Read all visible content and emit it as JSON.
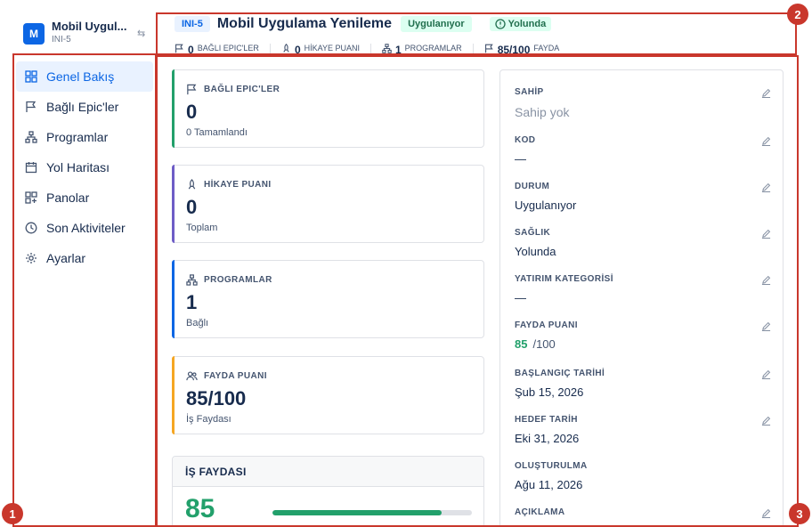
{
  "workspace": {
    "avatar_letter": "M",
    "name": "Mobil Uygul...",
    "key": "INI-5"
  },
  "sidebar": {
    "items": [
      {
        "label": "Genel Bakış",
        "icon": "grid-icon",
        "active": true
      },
      {
        "label": "Bağlı Epic'ler",
        "icon": "flag-icon",
        "active": false
      },
      {
        "label": "Programlar",
        "icon": "hierarchy-icon",
        "active": false
      },
      {
        "label": "Yol Haritası",
        "icon": "calendar-icon",
        "active": false
      },
      {
        "label": "Panolar",
        "icon": "dashboard-icon",
        "active": false
      },
      {
        "label": "Son Aktiviteler",
        "icon": "clock-icon",
        "active": false
      },
      {
        "label": "Ayarlar",
        "icon": "gear-icon",
        "active": false
      }
    ]
  },
  "header": {
    "key": "INI-5",
    "title": "Mobil Uygulama Yenileme",
    "status": "Uygulanıyor",
    "health": "Yolunda",
    "stats": [
      {
        "value": "0",
        "label": "BAĞLI EPIC'LER",
        "icon": "flag-icon"
      },
      {
        "value": "0",
        "label": "HİKAYE PUANI",
        "icon": "rocket-icon"
      },
      {
        "value": "1",
        "label": "PROGRAMLAR",
        "icon": "hierarchy-icon"
      },
      {
        "value": "85/100",
        "label": "FAYDA",
        "icon": "flag-icon"
      }
    ]
  },
  "cards": [
    {
      "title": "BAĞLI EPIC'LER",
      "value": "0",
      "sub": "0 Tamamlandı",
      "accent": "#22a06b",
      "icon": "flag-icon"
    },
    {
      "title": "HİKAYE PUANI",
      "value": "0",
      "sub": "Toplam",
      "accent": "#6e5dc6",
      "icon": "rocket-icon"
    },
    {
      "title": "PROGRAMLAR",
      "value": "1",
      "sub": "Bağlı",
      "accent": "#0c66e4",
      "icon": "hierarchy-icon"
    },
    {
      "title": "FAYDA PUANI",
      "value": "85/100",
      "sub": "İş Faydası",
      "accent": "#f5a623",
      "icon": "users-icon"
    }
  ],
  "business_value": {
    "title": "İŞ FAYDASI",
    "value": "85",
    "progress": 0.85
  },
  "details": {
    "fields": [
      {
        "label": "SAHİP",
        "value": "Sahip yok",
        "muted": true
      },
      {
        "label": "KOD",
        "value": "—"
      },
      {
        "label": "DURUM",
        "value": "Uygulanıyor"
      },
      {
        "label": "SAĞLIK",
        "value": "Yolunda"
      },
      {
        "label": "YATIRIM KATEGORİSİ",
        "value": "—"
      },
      {
        "label": "FAYDA PUANI",
        "value": "85",
        "total": "/100"
      },
      {
        "label": "BAŞLANGIÇ TARİHİ",
        "value": "Şub 15, 2026"
      },
      {
        "label": "HEDEF TARİH",
        "value": "Eki 31, 2026"
      },
      {
        "label": "OLUŞTURULMA",
        "value": "Ağu 11, 2026"
      },
      {
        "label": "AÇIKLAMA",
        "value": ""
      }
    ]
  },
  "annotations": [
    {
      "number": "1"
    },
    {
      "number": "2"
    },
    {
      "number": "3"
    }
  ],
  "colors": {
    "accent": "#0c66e4",
    "success": "#22a06b",
    "annotation": "#c9372c"
  }
}
